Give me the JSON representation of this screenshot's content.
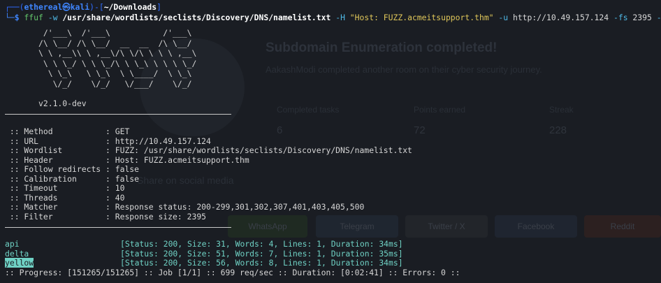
{
  "prompt": {
    "corner_top": "┌──(",
    "user": "ethereal㉿kali",
    "mid": ")-[",
    "path": "~/Downloads",
    "end": "]",
    "corner_bottom": "└─$ ",
    "cmd": "ffuf",
    "flag_w": " -w ",
    "wordlist_path": "/usr/share/wordlists/seclists/Discovery/DNS/namelist.txt",
    "flag_h": " -H ",
    "header_str": "\"Host: FUZZ.acmeitsupport.thm\"",
    "flag_u": " -u ",
    "url": "http://10.49.157.124",
    "flag_fs": " -fs ",
    "fs_val": "2395",
    "flag_c": " -c"
  },
  "banner": {
    "ascii": "        /'___\\  /'___\\           /'___\\\n       /\\ \\__/ /\\ \\__/  __  __  /\\ \\__/\n       \\ \\ ,__\\\\ \\ ,__\\/\\ \\/\\ \\ \\ \\ ,__\\\n        \\ \\ \\_/ \\ \\ \\_/\\ \\ \\_\\ \\ \\ \\ \\_/\n         \\ \\_\\   \\ \\_\\  \\ \\____/  \\ \\_\\\n          \\/_/    \\/_/   \\/___/    \\/_/",
    "version": "       v2.1.0-dev"
  },
  "config": [
    {
      "key": " :: Method           ",
      "value": ": GET"
    },
    {
      "key": " :: URL              ",
      "value": ": http://10.49.157.124"
    },
    {
      "key": " :: Wordlist         ",
      "value": ": FUZZ: /usr/share/wordlists/seclists/Discovery/DNS/namelist.txt"
    },
    {
      "key": " :: Header           ",
      "value": ": Host: FUZZ.acmeitsupport.thm"
    },
    {
      "key": " :: Follow redirects ",
      "value": ": false"
    },
    {
      "key": " :: Calibration      ",
      "value": ": false"
    },
    {
      "key": " :: Timeout          ",
      "value": ": 10"
    },
    {
      "key": " :: Threads          ",
      "value": ": 40"
    },
    {
      "key": " :: Matcher          ",
      "value": ": Response status: 200-299,301,302,307,401,403,405,500"
    },
    {
      "key": " :: Filter           ",
      "value": ": Response size: 2395"
    }
  ],
  "results": [
    {
      "word": "api",
      "status": "[Status: 200, Size: 31, Words: 4, Lines: 1, Duration: 34ms]"
    },
    {
      "word": "delta",
      "status": "[Status: 200, Size: 51, Words: 7, Lines: 1, Duration: 35ms]"
    },
    {
      "word": "yellow",
      "status": "[Status: 200, Size: 56, Words: 8, Lines: 1, Duration: 34ms]"
    }
  ],
  "progress": ":: Progress: [151265/151265] :: Job [1/1] :: 699 req/sec :: Duration: [0:02:41] :: Errors: 0 ::",
  "background": {
    "title": "Subdomain Enumeration completed!",
    "subtitle": "AakashModi completed another room on their cyber security journey.",
    "stats": [
      {
        "label": "Completed tasks",
        "value": "6"
      },
      {
        "label": "Points earned",
        "value": "72"
      },
      {
        "label": "Streak",
        "value": "228"
      }
    ],
    "share_heading": "Share on social media",
    "buttons": [
      "WhatsApp",
      "Telegram",
      "Twitter / X",
      "Facebook",
      "Reddit"
    ]
  },
  "colors": {
    "accent_blue": "#3f86ff",
    "cmd_green": "#62c46a",
    "string_yellow": "#e0c75a",
    "result_cyan": "#6fd1c4"
  }
}
